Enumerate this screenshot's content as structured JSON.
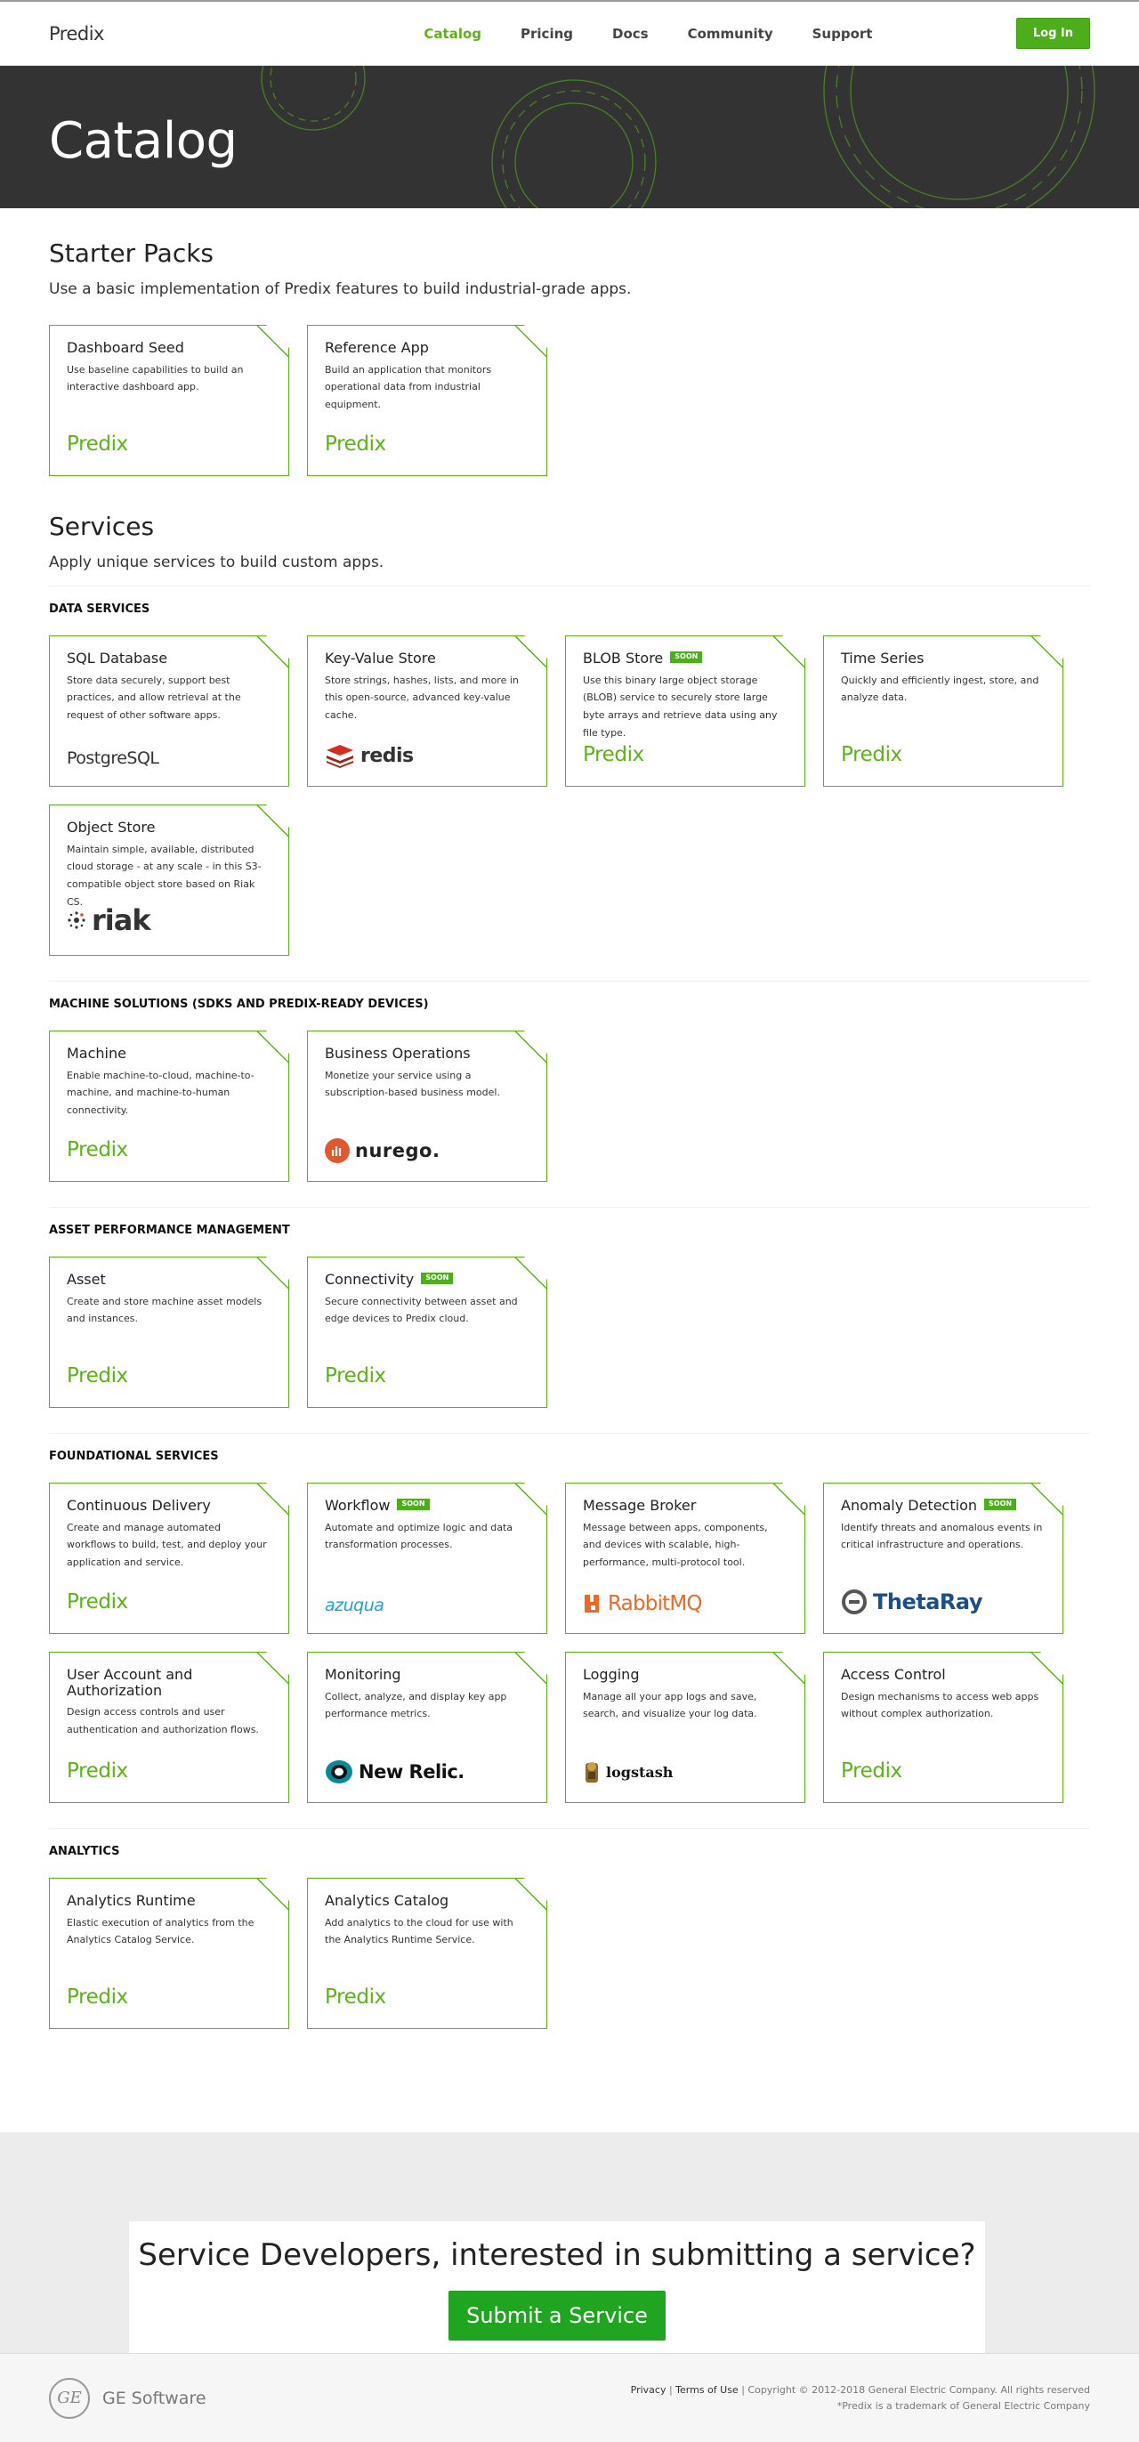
{
  "header": {
    "logo": "Predix",
    "nav": [
      "Catalog",
      "Pricing",
      "Docs",
      "Community",
      "Support"
    ],
    "login": "Log In"
  },
  "hero": {
    "title": "Catalog"
  },
  "starter": {
    "title": "Starter Packs",
    "subtitle": "Use a basic implementation of Predix features to build industrial-grade apps.",
    "cards": [
      {
        "title": "Dashboard Seed",
        "desc": "Use baseline capabilities to build an interactive dashboard app.",
        "brand": "Predix"
      },
      {
        "title": "Reference App",
        "desc": "Build an application that monitors operational data from industrial equipment.",
        "brand": "Predix"
      }
    ]
  },
  "services": {
    "title": "Services",
    "subtitle": "Apply unique services to build custom apps."
  },
  "categories": {
    "data": {
      "title": "DATA SERVICES",
      "cards": [
        {
          "title": "SQL Database",
          "desc": "Store data securely, support best practices, and allow retrieval at the request of other software apps.",
          "logo": "PostgreSQL"
        },
        {
          "title": "Key-Value Store",
          "desc": "Store strings, hashes, lists, and more in this open-source, advanced key-value cache.",
          "logo": "redis"
        },
        {
          "title": "BLOB Store",
          "soon": "SOON",
          "desc": "Use this binary large object storage (BLOB) service to securely store large byte arrays and retrieve data using any file type.",
          "brand": "Predix"
        },
        {
          "title": "Time Series",
          "desc": "Quickly and efficiently ingest, store, and analyze data.",
          "brand": "Predix"
        },
        {
          "title": "Object Store",
          "desc": "Maintain simple, available, distributed cloud storage - at any scale - in this S3-compatible object store based on Riak CS.",
          "logo": "riak"
        }
      ]
    },
    "machine": {
      "title": "MACHINE SOLUTIONS (SDKS AND PREDIX-READY DEVICES)",
      "cards": [
        {
          "title": "Machine",
          "desc": "Enable machine-to-cloud, machine-to-machine, and machine-to-human connectivity.",
          "brand": "Predix"
        },
        {
          "title": "Business Operations",
          "desc": "Monetize your service using a subscription-based business model.",
          "logo": "nurego."
        }
      ]
    },
    "apm": {
      "title": "ASSET PERFORMANCE MANAGEMENT",
      "cards": [
        {
          "title": "Asset",
          "desc": "Create and store machine asset models and instances.",
          "brand": "Predix"
        },
        {
          "title": "Connectivity",
          "soon": "SOON",
          "desc": "Secure connectivity between asset and edge devices to Predix cloud.",
          "brand": "Predix"
        }
      ]
    },
    "foundational": {
      "title": "FOUNDATIONAL SERVICES",
      "cards": [
        {
          "title": "Continuous Delivery",
          "desc": "Create and manage automated workflows to build, test, and deploy your application and service.",
          "brand": "Predix"
        },
        {
          "title": "Workflow",
          "soon": "SOON",
          "desc": "Automate and optimize logic and data transformation processes.",
          "logo": "azuqua"
        },
        {
          "title": "Message Broker",
          "desc": "Message between apps, components, and devices with scalable, high-performance, multi-protocol tool.",
          "logo": "RabbitMQ"
        },
        {
          "title": "Anomaly Detection",
          "soon": "SOON",
          "desc": "Identify threats and anomalous events in critical infrastructure and operations.",
          "logo": "ThetaRay"
        },
        {
          "title": "User Account and Authorization",
          "desc": "Design access controls and user authentication and authorization flows.",
          "brand": "Predix"
        },
        {
          "title": "Monitoring",
          "desc": "Collect, analyze, and display key app performance metrics.",
          "logo": "New Relic."
        },
        {
          "title": "Logging",
          "desc": "Manage all your app logs and save, search, and visualize your log data.",
          "logo": "logstash"
        },
        {
          "title": "Access Control",
          "desc": "Design mechanisms to access web apps without complex authorization.",
          "brand": "Predix"
        }
      ]
    },
    "analytics": {
      "title": "ANALYTICS",
      "cards": [
        {
          "title": "Analytics Runtime",
          "desc": "Elastic execution of analytics from the Analytics Catalog Service.",
          "brand": "Predix"
        },
        {
          "title": "Analytics Catalog",
          "desc": "Add analytics to the cloud for use with the Analytics Runtime Service.",
          "brand": "Predix"
        }
      ]
    }
  },
  "submit": {
    "heading": "Service Developers, interested in submitting a service?",
    "button": "Submit a Service"
  },
  "footer": {
    "brand": "GE Software",
    "privacy": "Privacy",
    "terms": "Terms of Use",
    "copyright": "Copyright © 2012-2018 General Electric Company. All rights reserved",
    "trademark": "*Predix is a trademark of General Electric Company"
  },
  "colors": {
    "accent": "#5bb316",
    "button": "#4cae1a",
    "hero": "#333333"
  }
}
